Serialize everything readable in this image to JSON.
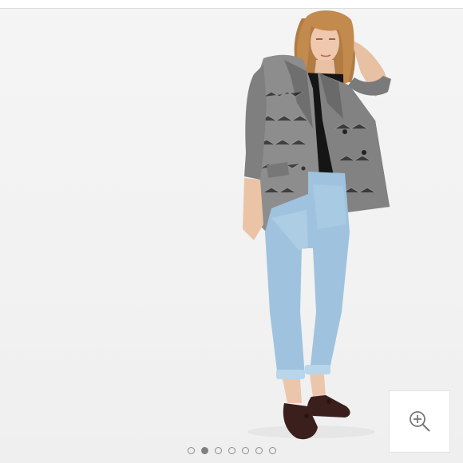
{
  "gallery": {
    "image_subject": "model-wearing-herringbone-blazer-and-light-wash-jeans",
    "slide_count": 7,
    "active_slide": 1,
    "zoom": {
      "icon": "zoom-in-icon"
    }
  },
  "colors": {
    "dot_active": "#7f7f7f",
    "dot_border": "#8c8c8c",
    "zoom_icon": "#777777",
    "background": "#f3f3f3"
  }
}
